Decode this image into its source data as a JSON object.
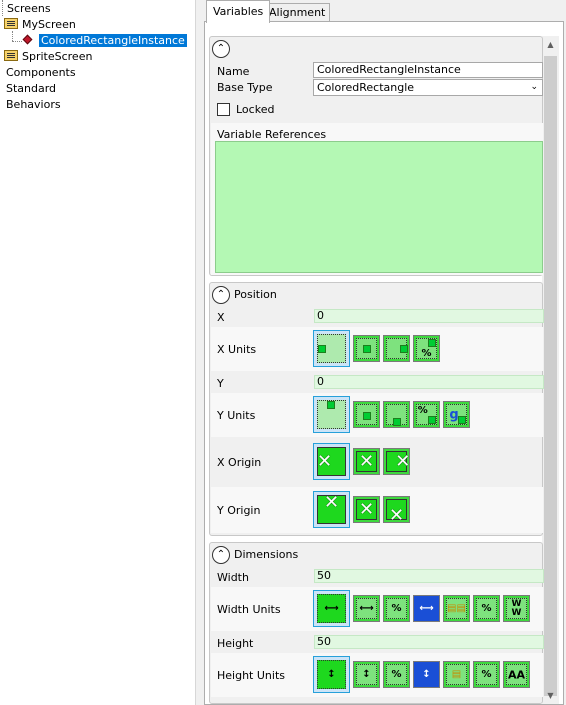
{
  "tree": {
    "items": [
      {
        "label": "Screens"
      },
      {
        "label": "MyScreen"
      },
      {
        "label": "ColoredRectangleInstance"
      },
      {
        "label": "SpriteScreen"
      },
      {
        "label": "Components"
      },
      {
        "label": "Standard"
      },
      {
        "label": "Behaviors"
      }
    ]
  },
  "tabs": [
    {
      "label": "Variables",
      "active": true
    },
    {
      "label": "Alignment",
      "active": false
    }
  ],
  "general": {
    "collapse_glyph": "⌃",
    "name_label": "Name",
    "name_value": "ColoredRectangleInstance",
    "base_type_label": "Base Type",
    "base_type_value": "ColoredRectangle",
    "locked_label": "Locked",
    "locked": false,
    "variable_references_label": "Variable References"
  },
  "position": {
    "title": "Position",
    "x_label": "X",
    "x_value": "0",
    "x_units_label": "X Units",
    "y_label": "Y",
    "y_value": "0",
    "y_units_label": "Y Units",
    "x_origin_label": "X Origin",
    "y_origin_label": "Y Origin",
    "x_units_percent_glyph": "%",
    "y_units_percent_glyph": "%",
    "y_units_baseline_glyph": "g"
  },
  "dimensions": {
    "title": "Dimensions",
    "width_label": "Width",
    "width_value": "50",
    "width_units_label": "Width Units",
    "height_label": "Height",
    "height_value": "50",
    "height_units_label": "Height Units",
    "percent_glyph": "%",
    "ratio_glyph": "W\nW",
    "text_glyph": "AA"
  },
  "colors": {
    "selection": "#0078d7",
    "value_bg": "#e1f8e1",
    "refs_bg": "#b4f8b4",
    "icon_green": "#3dd93d"
  }
}
